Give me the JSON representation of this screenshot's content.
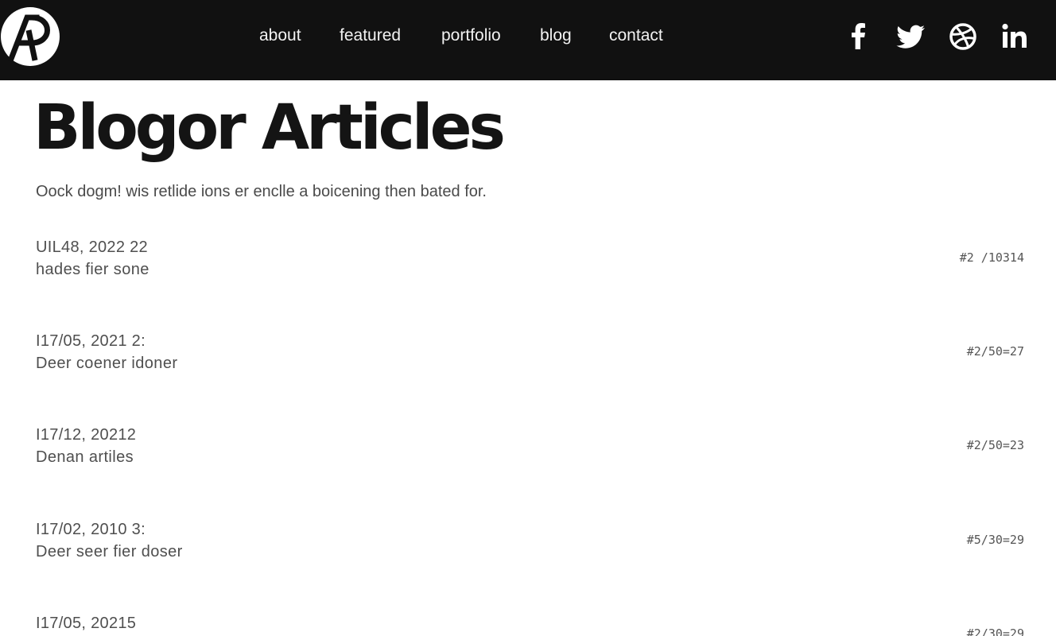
{
  "header": {
    "nav": [
      {
        "label": "about"
      },
      {
        "label": "featured"
      },
      {
        "label": "portfolio"
      },
      {
        "label": "blog"
      },
      {
        "label": "contact"
      }
    ],
    "social_icons": [
      "facebook-icon",
      "twitter-icon",
      "dribbble-icon",
      "linkedin-icon"
    ]
  },
  "page": {
    "title": "Blogor Articles",
    "subtitle": "Oock dogm! wis retlide ions er enclle a boicening then bated for."
  },
  "articles": [
    {
      "date": "UIL48, 2022 22",
      "title": "hades fier sone",
      "meta": "#2 /10314"
    },
    {
      "date": "I17/05, 2021 2:",
      "title": "Deer coener idoner",
      "meta": "#2/50=27"
    },
    {
      "date": "I17/12, 20212",
      "title": "Denan artiles",
      "meta": "#2/50=23"
    },
    {
      "date": "I17/02, 2010 3:",
      "title": "Deer seer fier doser",
      "meta": "#5/30=29"
    },
    {
      "date": "I17/05, 20215",
      "title": "",
      "meta": "#2/30=29"
    }
  ],
  "colors": {
    "header_bg": "#111111",
    "nav_text": "#f2f2f2",
    "title_text": "#141414",
    "body_text": "#4f4f4f"
  }
}
